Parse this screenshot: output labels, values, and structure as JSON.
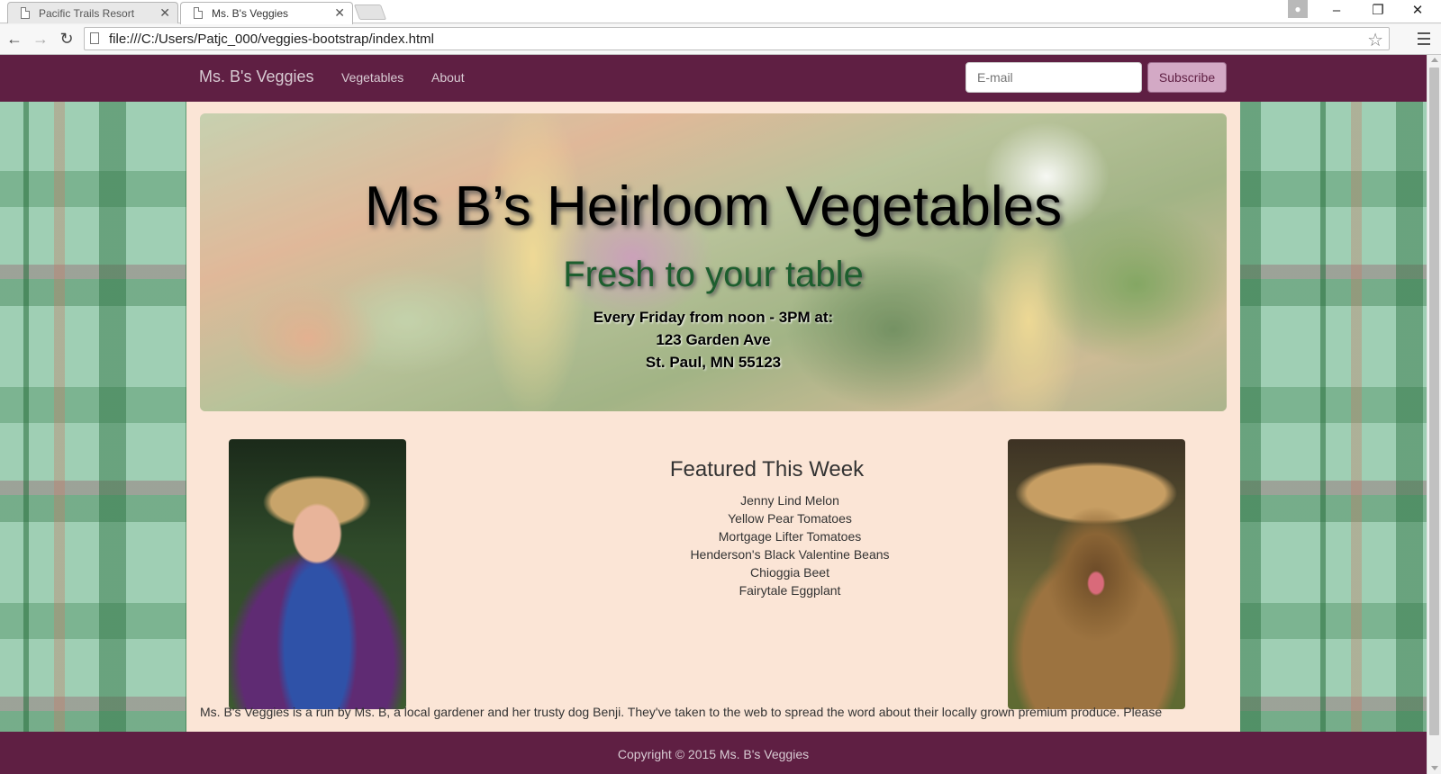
{
  "browser": {
    "tabs": [
      {
        "title": "Pacific Trails Resort",
        "active": false
      },
      {
        "title": "Ms. B's Veggies",
        "active": true
      }
    ],
    "url": "file:///C:/Users/Patjc_000/veggies-bootstrap/index.html",
    "icons": [
      "back-arrow-icon",
      "forward-arrow-icon",
      "reload-icon",
      "star-icon",
      "menu-icon",
      "profile-icon"
    ]
  },
  "nav": {
    "brand": "Ms. B's Veggies",
    "links": [
      "Vegetables",
      "About"
    ],
    "email_placeholder": "E-mail",
    "subscribe_label": "Subscribe"
  },
  "hero": {
    "title": "Ms B’s Heirloom Vegetables",
    "subtitle": "Fresh to your table",
    "schedule": "Every Friday from noon - 3PM at:",
    "address_line1": "123 Garden Ave",
    "address_line2": "St. Paul, MN 55123"
  },
  "featured": {
    "heading": "Featured This Week",
    "items": [
      "Jenny Lind Melon",
      "Yellow Pear Tomatoes",
      "Mortgage Lifter Tomatoes",
      "Henderson's Black Valentine Beans",
      "Chioggia Beet",
      "Fairytale Eggplant"
    ]
  },
  "intro_text": "Ms. B's Veggies is a run by Ms. B, a local gardener and her trusty dog Benji. They've taken to the web to spread the word about their locally grown premium produce. Please",
  "footer": {
    "copyright": "Copyright © 2015 Ms. B's Veggies"
  },
  "colors": {
    "navbar": "#5f1f43",
    "container": "#fbe5d6",
    "subtitle": "#1d5e2e",
    "subscribe_bg": "#d3a9c5"
  }
}
